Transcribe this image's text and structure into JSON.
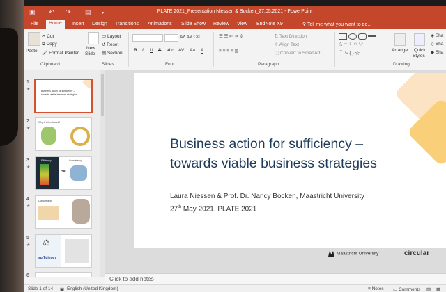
{
  "window": {
    "title": "PLATE 2021_Presentation Niessen & Bocken_27.05.2021 - PowerPoint"
  },
  "menu": {
    "tabs": [
      "File",
      "Home",
      "Insert",
      "Design",
      "Transitions",
      "Animations",
      "Slide Show",
      "Review",
      "View",
      "EndNote X9"
    ],
    "active": "Home",
    "tell_me": "Tell me what you want to do..."
  },
  "ribbon": {
    "clipboard": {
      "paste": "Paste",
      "cut": "Cut",
      "copy": "Copy",
      "format_painter": "Format Painter",
      "group": "Clipboard"
    },
    "slides": {
      "new_slide": "New",
      "new_slide2": "Slide",
      "layout": "Layout",
      "reset": "Reset",
      "section": "Section",
      "group": "Slides"
    },
    "font": {
      "bold": "B",
      "italic": "I",
      "underline": "U",
      "strike": "S",
      "shadow": "abc",
      "spacing": "AV",
      "case": "Aa",
      "color": "A",
      "group": "Font"
    },
    "paragraph": {
      "text_direction": "Text Direction",
      "align_text": "Align Text",
      "convert": "Convert to SmartArt",
      "group": "Paragraph"
    },
    "drawing": {
      "arrange": "Arrange",
      "quick_styles": "Quick",
      "quick_styles2": "Styles",
      "shape1": "Sha",
      "shape2": "Sha",
      "shape3": "Sha",
      "group": "Drawing"
    }
  },
  "thumbnails": [
    {
      "num": "1",
      "line1": "Business action for sufficiency –",
      "line2": "towards viable business strategies"
    },
    {
      "num": "2",
      "line1": "Why is this relevant?"
    },
    {
      "num": "3",
      "line1": "Efficiency",
      "line2": "OR",
      "line3": "Consistency"
    },
    {
      "num": "4",
      "line1": "Consumption"
    },
    {
      "num": "5",
      "line1": "sufficiency"
    },
    {
      "num": "6"
    }
  ],
  "slide": {
    "title_line1": "Business action for sufficiency –",
    "title_line2": "towards viable business strategies",
    "authors": "Laura Niessen & Prof. Dr. Nancy Bocken, Maastricht University",
    "date_prefix": "27",
    "date_sup": "th",
    "date_rest": " May 2021, PLATE 2021",
    "logo_mu": "Maastricht University",
    "logo_ce": "circular"
  },
  "notes_placeholder": "Click to add notes",
  "status": {
    "slide_count": "Slide 1 of 14",
    "language": "English (United Kingdom)",
    "notes": "Notes",
    "comments": "Comments"
  },
  "colors": {
    "accent": "#c4462b",
    "title_blue": "#1f3b5a",
    "deco_light": "#fbe3c3",
    "deco_yellow": "#f9cf7a"
  }
}
